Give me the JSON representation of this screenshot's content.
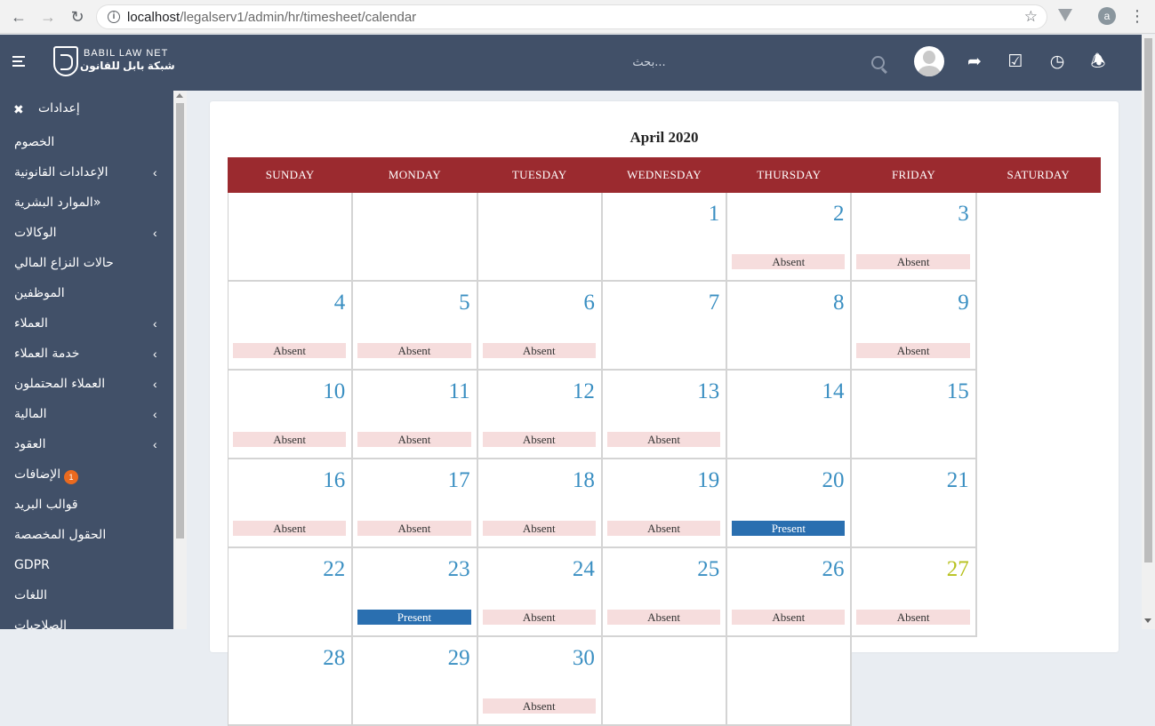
{
  "browser": {
    "url_host": "localhost",
    "url_path": "/legalserv1/admin/hr/timesheet/calendar",
    "account_initial": "a"
  },
  "header": {
    "logo_en": "BABIL LAW NET",
    "logo_ar": "شبكة بابل للقانون",
    "search_placeholder": "بحث..."
  },
  "sidebar": {
    "title": "إعدادات",
    "items": [
      {
        "label": "الخصوم",
        "chevron": false
      },
      {
        "label": "الإعدادات القانونية",
        "chevron": true
      },
      {
        "label": "الموارد البشرية»",
        "chevron": false
      },
      {
        "label": "الوكالات",
        "chevron": true
      },
      {
        "label": "حالات النزاع المالي",
        "chevron": false
      },
      {
        "label": "الموظفين",
        "chevron": false
      },
      {
        "label": "العملاء",
        "chevron": true
      },
      {
        "label": "خدمة العملاء",
        "chevron": true
      },
      {
        "label": "العملاء المحتملون",
        "chevron": true
      },
      {
        "label": "المالية",
        "chevron": true
      },
      {
        "label": "العقود",
        "chevron": true
      },
      {
        "label": "الإضافات",
        "chevron": false,
        "badge": "1"
      },
      {
        "label": "قوالب البريد",
        "chevron": false
      },
      {
        "label": "الحقول المخصصة",
        "chevron": false
      },
      {
        "label": "GDPR",
        "chevron": false
      },
      {
        "label": "اللغات",
        "chevron": false
      },
      {
        "label": "الصلاحيات",
        "chevron": false
      }
    ]
  },
  "calendar": {
    "title": "April 2020",
    "weekdays": [
      "SUNDAY",
      "MONDAY",
      "TUESDAY",
      "WEDNESDAY",
      "THURSDAY",
      "FRIDAY",
      "SATURDAY"
    ],
    "today": 27,
    "leading_blanks": 3,
    "days": [
      {
        "day": 1,
        "status": ""
      },
      {
        "day": 2,
        "status": "Absent"
      },
      {
        "day": 3,
        "status": "Absent"
      },
      {
        "day": 4,
        "status": "Absent"
      },
      {
        "day": 5,
        "status": "Absent"
      },
      {
        "day": 6,
        "status": "Absent"
      },
      {
        "day": 7,
        "status": ""
      },
      {
        "day": 8,
        "status": ""
      },
      {
        "day": 9,
        "status": "Absent"
      },
      {
        "day": 10,
        "status": "Absent"
      },
      {
        "day": 11,
        "status": "Absent"
      },
      {
        "day": 12,
        "status": "Absent"
      },
      {
        "day": 13,
        "status": "Absent"
      },
      {
        "day": 14,
        "status": ""
      },
      {
        "day": 15,
        "status": ""
      },
      {
        "day": 16,
        "status": "Absent"
      },
      {
        "day": 17,
        "status": "Absent"
      },
      {
        "day": 18,
        "status": "Absent"
      },
      {
        "day": 19,
        "status": "Absent"
      },
      {
        "day": 20,
        "status": "Present"
      },
      {
        "day": 21,
        "status": ""
      },
      {
        "day": 22,
        "status": ""
      },
      {
        "day": 23,
        "status": "Present"
      },
      {
        "day": 24,
        "status": "Absent"
      },
      {
        "day": 25,
        "status": "Absent"
      },
      {
        "day": 26,
        "status": "Absent"
      },
      {
        "day": 27,
        "status": "Absent"
      },
      {
        "day": 28,
        "status": ""
      },
      {
        "day": 29,
        "status": ""
      },
      {
        "day": 30,
        "status": "Absent"
      }
    ]
  },
  "colors": {
    "header_bg": "#415068",
    "calendar_header_bg": "#9b2a2f",
    "day_number": "#3a8fc2",
    "today_number": "#b7c11d",
    "absent_bg": "#f6dddd",
    "present_bg": "#2a6fb0"
  }
}
